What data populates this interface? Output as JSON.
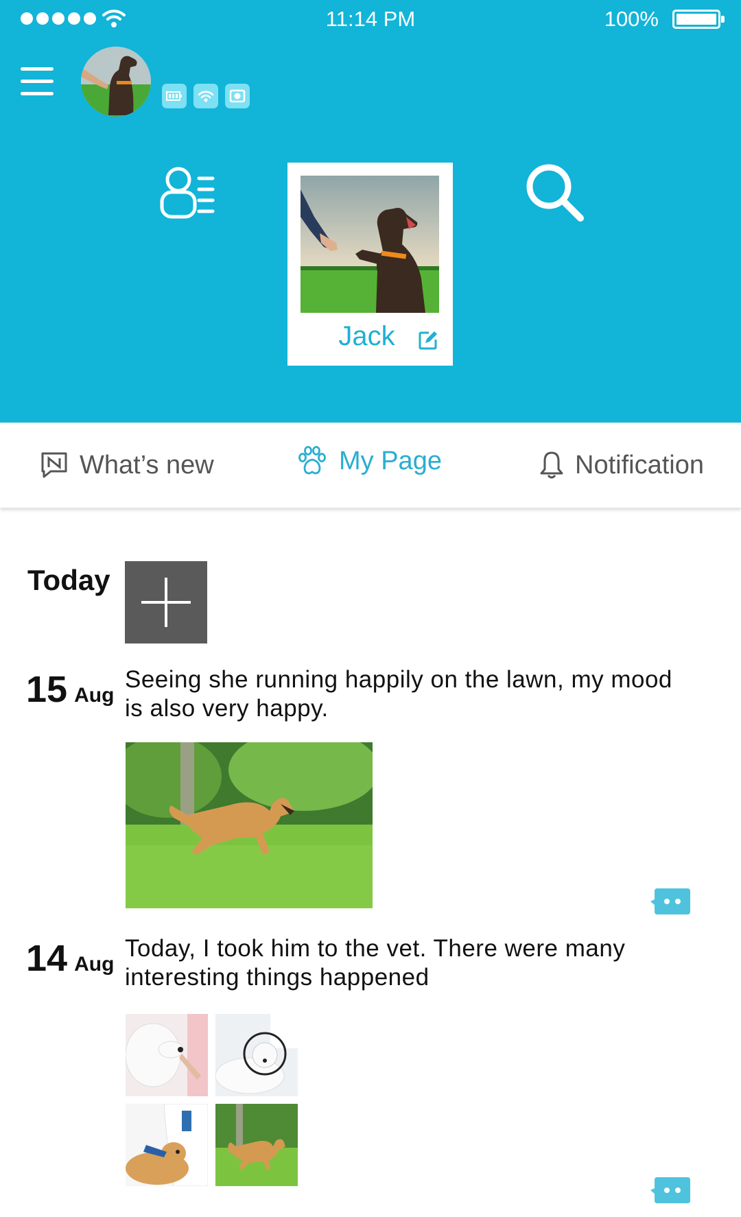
{
  "status_bar": {
    "time": "11:14 PM",
    "battery": "100%"
  },
  "header": {
    "badges": [
      "battery-icon",
      "wifi-icon",
      "camera-icon"
    ],
    "pet_name": "Jack"
  },
  "tabs": [
    {
      "label": "What’s new",
      "icon": "news-icon",
      "active": false
    },
    {
      "label": "My Page",
      "icon": "paw-icon",
      "active": true
    },
    {
      "label": "Notification",
      "icon": "bell-icon",
      "active": false
    }
  ],
  "timeline": {
    "today_label": "Today",
    "entries": [
      {
        "day": "15",
        "month": "Aug",
        "text": "Seeing she running happily on the lawn, my mood is also very happy."
      },
      {
        "day": "14",
        "month": "Aug",
        "text": "Today, I took him to the vet. There were many interesting things happened"
      }
    ]
  },
  "colors": {
    "brand": "#12b4d8",
    "accent_text": "#2aaed0",
    "badge": "#7de0f3",
    "add_button": "#5a5a5a"
  }
}
